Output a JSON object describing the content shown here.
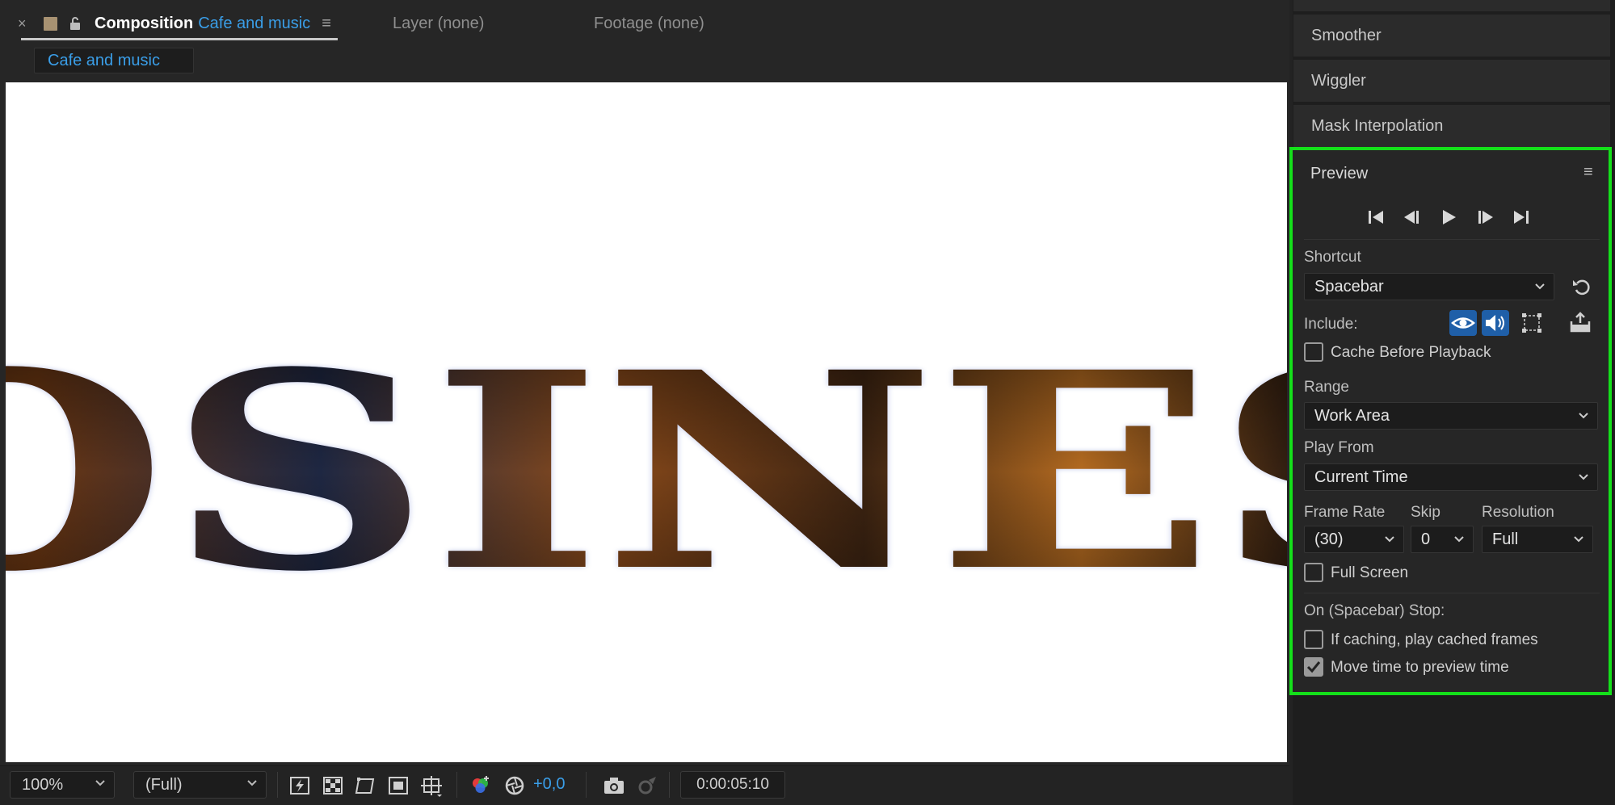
{
  "comp_tabs": {
    "active": {
      "close": "×",
      "label": "Composition",
      "name": "Cafe and music",
      "menu": "≡"
    },
    "layer": "Layer (none)",
    "footage": "Footage (none)",
    "subtab": "Cafe and music"
  },
  "viewer": {
    "word": "COSINESS"
  },
  "toolbar": {
    "zoom": "100%",
    "resolution": "(Full)",
    "exposure": "+0,0",
    "timecode": "0:00:05:10",
    "icons": [
      "fast-previews-icon",
      "transparency-grid-icon",
      "mask-path-icon",
      "region-of-interest-icon",
      "guides-icon",
      "channel-icon",
      "reset-exposure-icon",
      "snapshot-icon",
      "show-snapshot-icon"
    ]
  },
  "right_panel": {
    "accordions": [
      "Smoother",
      "Wiggler",
      "Mask Interpolation"
    ]
  },
  "preview": {
    "title": "Preview",
    "menu": "≡",
    "transport": [
      "first-frame-icon",
      "previous-frame-icon",
      "play-icon",
      "next-frame-icon",
      "last-frame-icon"
    ],
    "shortcut_label": "Shortcut",
    "shortcut_value": "Spacebar",
    "include_label": "Include:",
    "cache_before_playback": {
      "label": "Cache Before Playback",
      "checked": false
    },
    "range_label": "Range",
    "range_value": "Work Area",
    "play_from_label": "Play From",
    "play_from_value": "Current Time",
    "frame_rate_label": "Frame Rate",
    "frame_rate_value": "(30)",
    "skip_label": "Skip",
    "skip_value": "0",
    "resolution_label": "Resolution",
    "resolution_value": "Full",
    "full_screen": {
      "label": "Full Screen",
      "checked": false
    },
    "on_stop_label": "On (Spacebar) Stop:",
    "if_caching": {
      "label": "If caching, play cached frames",
      "checked": false
    },
    "move_time": {
      "label": "Move time to preview time",
      "checked": true
    },
    "highlight_color": "#14e01a",
    "accent_color": "#3a9ee8"
  }
}
